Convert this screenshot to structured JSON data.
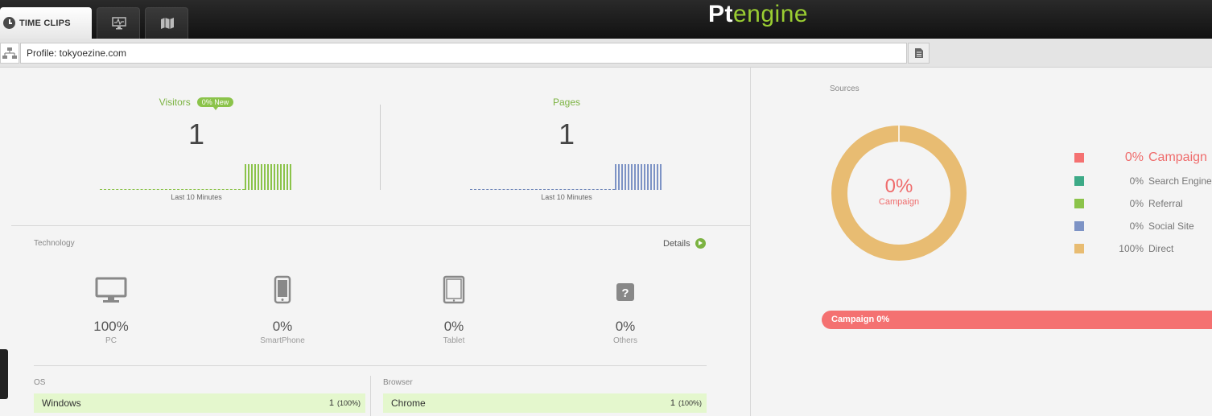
{
  "header": {
    "tabs": [
      {
        "label": "TIME CLIPS",
        "icon": "clock-icon",
        "active": true
      },
      {
        "label": "",
        "icon": "monitor-pulse-icon",
        "active": false
      },
      {
        "label": "",
        "icon": "map-icon",
        "active": false
      }
    ],
    "logo_pt": "Pt",
    "logo_engine": "engine"
  },
  "profile": {
    "value": "Profile: tokyoezine.com"
  },
  "stats": {
    "visitors": {
      "title": "Visitors",
      "badge": "0% New",
      "value": "1",
      "caption": "Last 10 Minutes"
    },
    "pages": {
      "title": "Pages",
      "value": "1",
      "caption": "Last 10 Minutes"
    }
  },
  "technology": {
    "title": "Technology",
    "details": "Details",
    "items": [
      {
        "icon": "desktop-icon",
        "pct": "100%",
        "name": "PC"
      },
      {
        "icon": "smartphone-icon",
        "pct": "0%",
        "name": "SmartPhone"
      },
      {
        "icon": "tablet-icon",
        "pct": "0%",
        "name": "Tablet"
      },
      {
        "icon": "question-icon",
        "pct": "0%",
        "name": "Others"
      }
    ]
  },
  "os": {
    "title": "OS",
    "rows": [
      {
        "name": "Windows",
        "count": "1",
        "pct": "(100%)"
      }
    ]
  },
  "browser": {
    "title": "Browser",
    "rows": [
      {
        "name": "Chrome",
        "count": "1",
        "pct": "(100%)"
      }
    ]
  },
  "sources": {
    "title": "Sources",
    "center_pct": "0%",
    "center_label": "Campaign",
    "legend": [
      {
        "value": "0%",
        "name": "Campaign",
        "color": "#f47171",
        "active": true
      },
      {
        "value": "0%",
        "name": "Search Engine",
        "color": "#3daa87",
        "active": false
      },
      {
        "value": "0%",
        "name": "Referral",
        "color": "#8bc34a",
        "active": false
      },
      {
        "value": "0%",
        "name": "Social Site",
        "color": "#7d93c5",
        "active": false
      },
      {
        "value": "100%",
        "name": "Direct",
        "color": "#e8bc72",
        "active": false
      }
    ],
    "bar_label": "Campaign 0%"
  },
  "colors": {
    "accent_green": "#8bc34a",
    "accent_red": "#f47171",
    "donut": "#e8bc72"
  }
}
